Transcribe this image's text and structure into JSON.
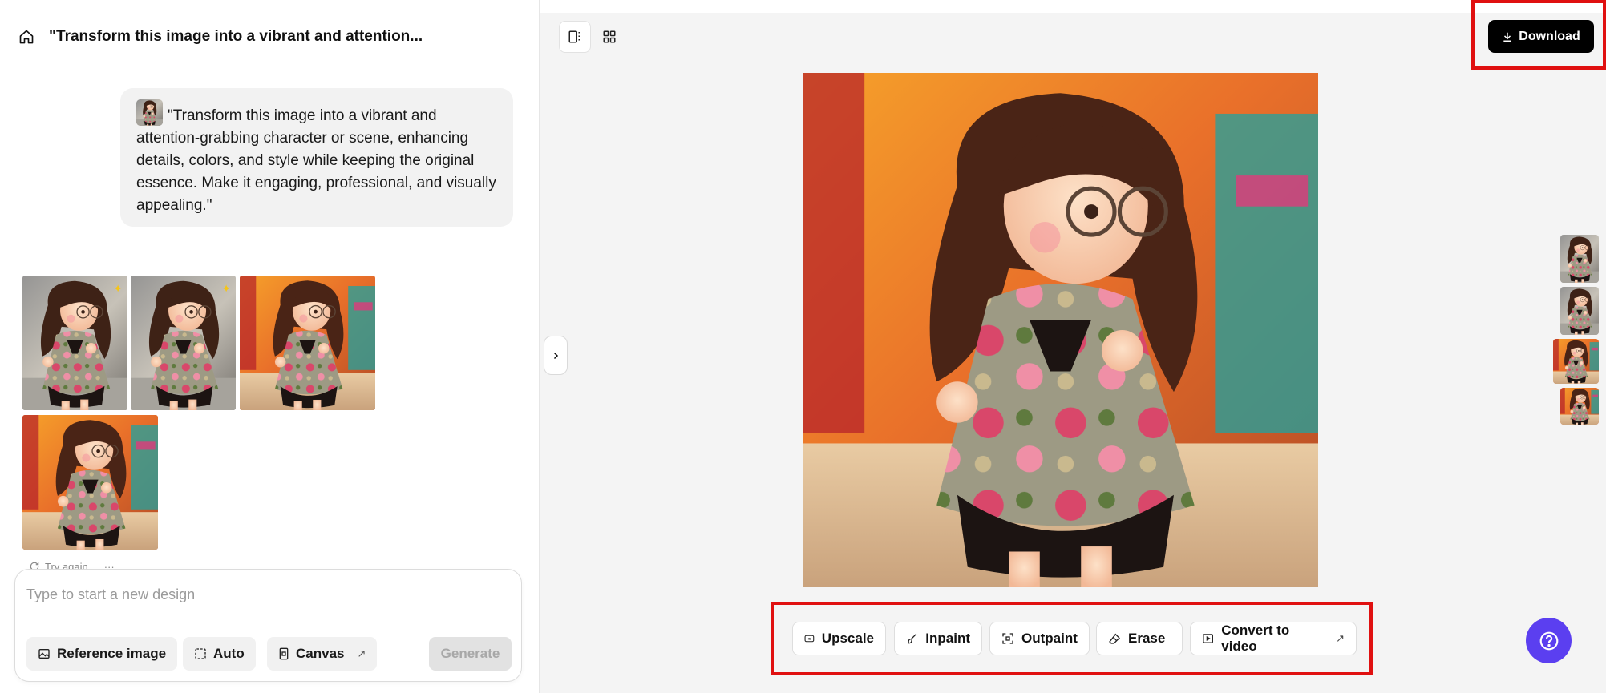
{
  "header": {
    "title": "\"Transform this image into a vibrant and attention..."
  },
  "prompt_bubble": {
    "text": "\"Transform this image into a vibrant and attention-grabbing character or scene, enhancing details, colors, and style while keeping the original essence. Make it engaging, professional, and visually appealing.\""
  },
  "results": {
    "try_again_label": "Try again"
  },
  "composer": {
    "placeholder": "Type to start a new design",
    "reference_label": "Reference image",
    "auto_label": "Auto",
    "canvas_label": "Canvas",
    "generate_label": "Generate"
  },
  "toolbar": {
    "download_label": "Download"
  },
  "tools": {
    "upscale_label": "Upscale",
    "inpaint_label": "Inpaint",
    "outpaint_label": "Outpaint",
    "erase_label": "Erase",
    "convert_label": "Convert to video"
  },
  "icons": {
    "home": "home-icon",
    "single_view": "single-view-icon",
    "grid_view": "grid-view-icon",
    "chevron": "chevron-right-icon",
    "download": "download-icon",
    "help": "help-icon"
  },
  "colors": {
    "highlight": "#e01010",
    "primary_button": "#000000",
    "help_button": "#5b3ff0"
  }
}
